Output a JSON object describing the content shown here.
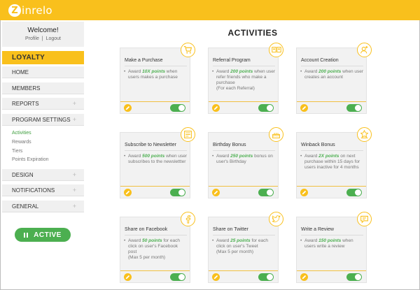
{
  "brand": {
    "logo_mark": "Z",
    "logo_text": "inrelo"
  },
  "sidebar": {
    "welcome_title": "Welcome!",
    "profile_link": "Profile",
    "link_separator": "|",
    "logout_link": "Logout",
    "section_title": "LOYALTY",
    "nav": [
      {
        "label": "HOME",
        "expandable": false
      },
      {
        "label": "MEMBERS",
        "expandable": false
      },
      {
        "label": "REPORTS",
        "expandable": true
      },
      {
        "label": "PROGRAM SETTINGS",
        "expandable": true
      },
      {
        "label": "DESIGN",
        "expandable": true
      },
      {
        "label": "NOTIFICATIONS",
        "expandable": true
      },
      {
        "label": "GENERAL",
        "expandable": true
      }
    ],
    "sub_nav": [
      {
        "label": "Activities",
        "active": true
      },
      {
        "label": "Rewards",
        "active": false
      },
      {
        "label": "Tiers",
        "active": false
      },
      {
        "label": "Points Expiration",
        "active": false
      }
    ],
    "plus_glyph": "+",
    "status_button": "ACTIVE"
  },
  "main": {
    "title": "ACTIVITIES",
    "bullet_glyph": "•",
    "cards": [
      {
        "title": "Make a Purchase",
        "pre": "Award ",
        "points": "10X points",
        "post": " when users makes a purchase",
        "extra": "",
        "icon": "cart-icon",
        "enabled": true
      },
      {
        "title": "Referral Program",
        "pre": "Award ",
        "points": "200 points",
        "post": " when user refer friends who make a purchase",
        "extra": "(For each Referral)",
        "icon": "referral-icon",
        "enabled": true
      },
      {
        "title": "Account Creation",
        "pre": "Award ",
        "points": "200 points",
        "post": " when user creates an account",
        "extra": "",
        "icon": "add-user-icon",
        "enabled": true
      },
      {
        "title": "Subscribe to Newsletter",
        "pre": "Award ",
        "points": "500 points",
        "post": " when user subscribes to the newslettter",
        "extra": "",
        "icon": "newsletter-icon",
        "enabled": true
      },
      {
        "title": "Birthday Bonus",
        "pre": "Award ",
        "points": "250 points",
        "post": " bonus on user's Birthday",
        "extra": "",
        "icon": "cake-icon",
        "enabled": true
      },
      {
        "title": "Winback Bonus",
        "pre": "Award ",
        "points": "2X points",
        "post": " on next purchase within 15 days for users inactive for 4 months",
        "extra": "",
        "icon": "winback-icon",
        "enabled": true
      },
      {
        "title": "Share on Facebook",
        "pre": "Award ",
        "points": "50 points",
        "post": " for each click on user's Facebook post",
        "extra": "(Max 5 per month)",
        "icon": "facebook-icon",
        "enabled": true
      },
      {
        "title": "Share on Twitter",
        "pre": "Award ",
        "points": "25 points",
        "post": " for each click on user's Tweet",
        "extra": "(Max 5 per month)",
        "icon": "twitter-icon",
        "enabled": true
      },
      {
        "title": "Write a Review",
        "pre": "Award ",
        "points": "150 points",
        "post": " when users write a review",
        "extra": "",
        "icon": "review-icon",
        "enabled": true
      }
    ]
  },
  "colors": {
    "brand_yellow": "#f9c01c",
    "active_green": "#4caf50",
    "points_green": "#4caf50"
  }
}
